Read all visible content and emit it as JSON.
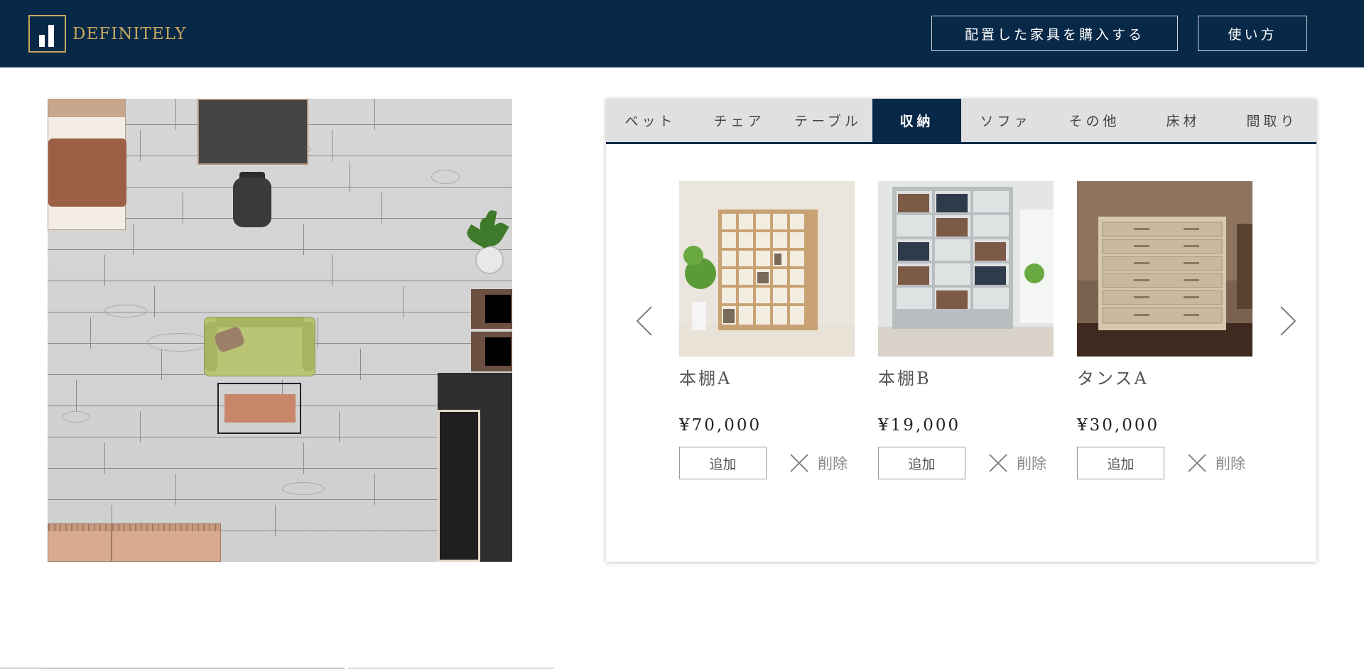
{
  "header": {
    "logo_text": "DEFINITELY",
    "buy_button": "配置した家具を購入する",
    "howto_button": "使い方"
  },
  "tabs": [
    {
      "label": "ベット",
      "active": false
    },
    {
      "label": "チェア",
      "active": false
    },
    {
      "label": "テーブル",
      "active": false
    },
    {
      "label": "収納",
      "active": true
    },
    {
      "label": "ソファ",
      "active": false
    },
    {
      "label": "その他",
      "active": false
    },
    {
      "label": "床材",
      "active": false
    },
    {
      "label": "間取り",
      "active": false
    }
  ],
  "products": [
    {
      "name": "本棚A",
      "price": "¥70,000",
      "add_label": "追加",
      "delete_label": "削除"
    },
    {
      "name": "本棚B",
      "price": "¥19,000",
      "add_label": "追加",
      "delete_label": "削除"
    },
    {
      "name": "タンスA",
      "price": "¥30,000",
      "add_label": "追加",
      "delete_label": "削除"
    }
  ],
  "colors": {
    "navy": "#082848",
    "gold": "#c8a85e"
  },
  "icons": {
    "prev": "chevron-left-icon",
    "next": "chevron-right-icon",
    "delete": "close-icon"
  }
}
